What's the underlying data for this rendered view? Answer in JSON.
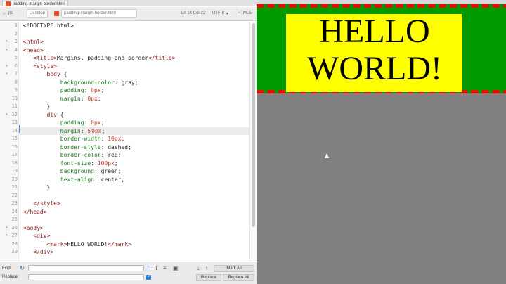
{
  "editor": {
    "tabs": [
      {
        "label": "padding-margin-border.html",
        "active": true
      }
    ],
    "path_bar": {
      "root": "ps",
      "folder": "Desktop",
      "file": "padding-margin-border.html",
      "cursor": "Ln 14 Col 22",
      "encoding": "UTF-8",
      "language": "HTML5"
    },
    "line_numbers": [
      "1",
      "2",
      "3",
      "4",
      "5",
      "6",
      "7",
      "8",
      "9",
      "10",
      "11",
      "12",
      "13",
      "14",
      "15",
      "16",
      "17",
      "18",
      "19",
      "20",
      "21",
      "22",
      "23",
      "24",
      "25",
      "26",
      "27",
      "28",
      "29"
    ],
    "code": {
      "l1": "<!DOCTYPE html>",
      "l3_tag": "<html>",
      "l4_tag": "<head>",
      "l5_open": "<title>",
      "l5_text": "Margins, padding and border",
      "l5_close": "</title>",
      "l6_tag": "<style>",
      "l7_sel": "body",
      "l7_brace": " {",
      "l8_prop": "background-color",
      "l8_val": ": gray;",
      "l9_prop": "padding",
      "l9_num": "0px",
      "l10_prop": "margin",
      "l10_num": "0px",
      "l11": "}",
      "l12_sel": "div",
      "l12_brace": " {",
      "l13_prop": "padding",
      "l13_num": "0px",
      "l14_prop": "margin",
      "l14_num_a": "5",
      "l14_num_b": "0px",
      "l15_prop": "border-width",
      "l15_num": "10px",
      "l16_prop": "border-style",
      "l16_val": ": dashed;",
      "l17_prop": "border-color",
      "l17_val": ": red;",
      "l18_prop": "font-size",
      "l18_num": "100px",
      "l19_prop": "background",
      "l19_val": ": green;",
      "l20_prop": "text-align",
      "l20_val": ": center;",
      "l21": "}",
      "l23_tag": "</style>",
      "l24_tag": "</head>",
      "l26_tag": "<body>",
      "l27_tag": "<div>",
      "l28_open": "<mark>",
      "l28_text": "HELLO WORLD!",
      "l28_close": "</mark>",
      "l29_tag": "</div>"
    }
  },
  "findbar": {
    "find_label": "Find:",
    "replace_label": "Replace:",
    "mark_all": "Mark All",
    "replace": "Replace",
    "replace_all": "Replace All"
  },
  "preview": {
    "line1": "HELLO",
    "line2": "WORLD!",
    "colors": {
      "page": "#808080",
      "div_bg": "#009a00",
      "border": "#ff0000",
      "mark": "#ffff00"
    }
  }
}
